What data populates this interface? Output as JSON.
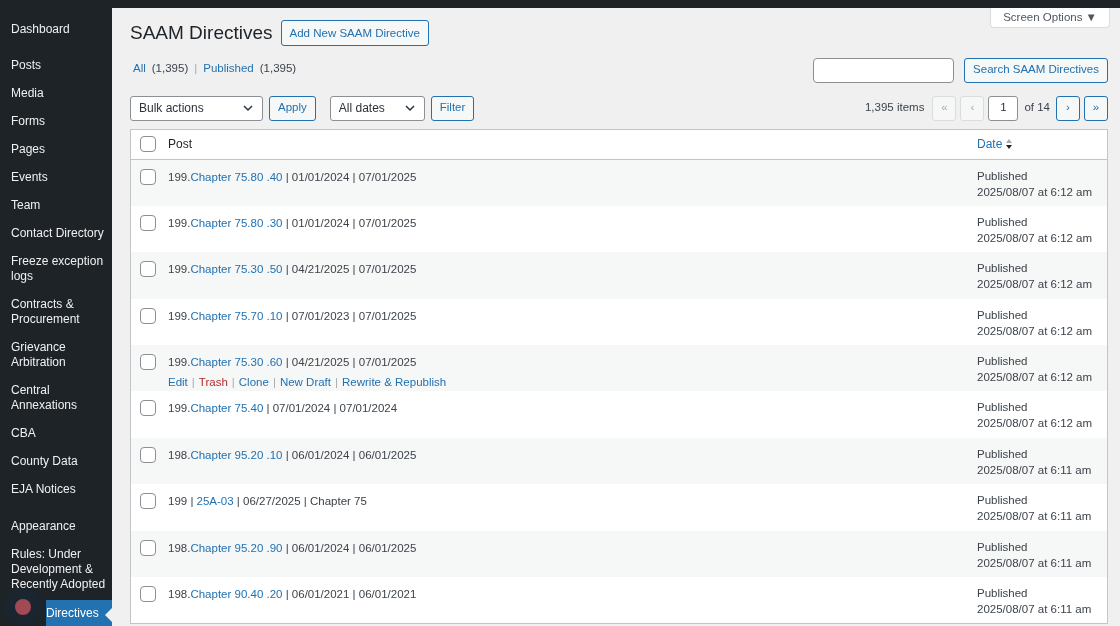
{
  "sidebar": {
    "items": [
      {
        "label": "Dashboard",
        "selected": false
      },
      {
        "label": "Posts",
        "selected": false
      },
      {
        "label": "Media",
        "selected": false
      },
      {
        "label": "Forms",
        "selected": false
      },
      {
        "label": "Pages",
        "selected": false
      },
      {
        "label": "Events",
        "selected": false
      },
      {
        "label": "Team",
        "selected": false
      },
      {
        "label": "Contact Directory",
        "selected": false
      },
      {
        "label": "Freeze exception logs",
        "selected": false
      },
      {
        "label": "Contracts & Procurement",
        "selected": false
      },
      {
        "label": "Grievance Arbitration",
        "selected": false
      },
      {
        "label": "Central Annexations",
        "selected": false
      },
      {
        "label": "CBA",
        "selected": false
      },
      {
        "label": "County Data",
        "selected": false
      },
      {
        "label": "EJA Notices",
        "selected": false
      },
      {
        "label": "Appearance",
        "selected": false
      },
      {
        "label": "Rules: Under Development & Recently Adopted",
        "selected": false
      },
      {
        "label": "Directives",
        "selected": true
      }
    ]
  },
  "title": "SAAM Directives",
  "add_button": "Add New SAAM Directive",
  "screen_options": "Screen Options ▼",
  "view_separator": "|",
  "action_separator": "|",
  "select_all": {
    "checked": false
  },
  "views": [
    {
      "label": "All",
      "count": "(1,395)"
    },
    {
      "label": "Published",
      "count": "(1,395)"
    }
  ],
  "search_button": "Search SAAM Directives",
  "bulk_actions": {
    "value": "Bulk actions",
    "button": "Apply"
  },
  "dates": {
    "value": "All dates",
    "button": "Filter"
  },
  "pagination": {
    "items": "1,395 items",
    "first": "«",
    "prev": "‹",
    "page": "1",
    "of": "of 14",
    "next": "›",
    "last": "»"
  },
  "table": {
    "columns": [
      {
        "label": "Post"
      },
      {
        "label": "Date"
      }
    ],
    "rows": [
      {
        "prefix": "199.",
        "link": "Chapter 75.80 .40",
        "suffix": " | 01/01/2024 | 07/01/2025",
        "status": "Published",
        "date": "2025/08/07 at 6:12 am",
        "checked": false
      },
      {
        "prefix": "199.",
        "link": "Chapter 75.80 .30",
        "suffix": " | 01/01/2024 | 07/01/2025",
        "status": "Published",
        "date": "2025/08/07 at 6:12 am",
        "checked": false
      },
      {
        "prefix": "199.",
        "link": "Chapter 75.30 .50",
        "suffix": " | 04/21/2025 | 07/01/2025",
        "status": "Published",
        "date": "2025/08/07 at 6:12 am",
        "checked": false
      },
      {
        "prefix": "199.",
        "link": "Chapter 75.70 .10",
        "suffix": " | 07/01/2023 | 07/01/2025",
        "status": "Published",
        "date": "2025/08/07 at 6:12 am",
        "checked": false
      },
      {
        "prefix": "199.",
        "link": "Chapter 75.30 .60",
        "suffix": " | 04/21/2025 | 07/01/2025",
        "status": "Published",
        "date": "2025/08/07 at 6:12 am",
        "checked": false,
        "actions": [
          {
            "label": "Edit",
            "kind": "link"
          },
          {
            "label": "Trash",
            "kind": "trash"
          },
          {
            "label": "Clone",
            "kind": "link"
          },
          {
            "label": "New Draft",
            "kind": "link"
          },
          {
            "label": "Rewrite & Republish",
            "kind": "link"
          }
        ]
      },
      {
        "prefix": "199.",
        "link": "Chapter 75.40",
        "suffix": " | 07/01/2024 | 07/01/2024",
        "status": "Published",
        "date": "2025/08/07 at 6:12 am",
        "checked": false
      },
      {
        "prefix": "198.",
        "link": "Chapter 95.20 .10",
        "suffix": " | 06/01/2024 | 06/01/2025",
        "status": "Published",
        "date": "2025/08/07 at 6:11 am",
        "checked": false
      },
      {
        "prefix": "199 | ",
        "link": "25A-03",
        "suffix": " | 06/27/2025 | Chapter 75",
        "status": "Published",
        "date": "2025/08/07 at 6:11 am",
        "checked": false
      },
      {
        "prefix": "198.",
        "link": "Chapter 95.20 .90",
        "suffix": " | 06/01/2024 | 06/01/2025",
        "status": "Published",
        "date": "2025/08/07 at 6:11 am",
        "checked": false
      },
      {
        "prefix": "198.",
        "link": "Chapter 90.40 .20",
        "suffix": " | 06/01/2021 | 06/01/2021",
        "status": "Published",
        "date": "2025/08/07 at 6:11 am",
        "checked": false
      }
    ]
  }
}
